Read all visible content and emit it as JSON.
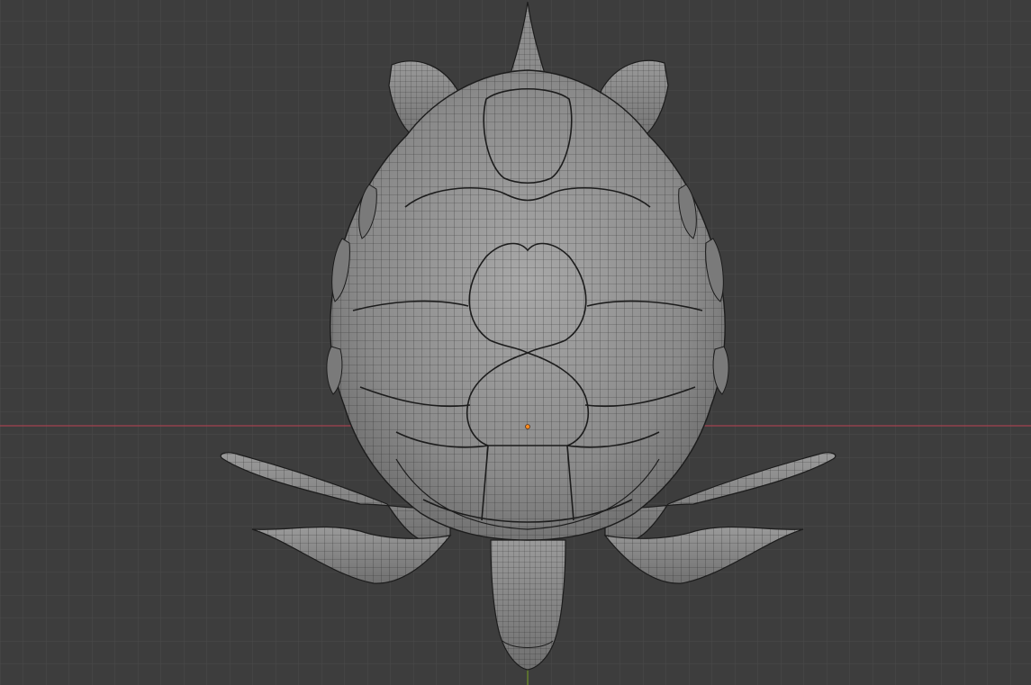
{
  "viewport": {
    "kind": "3d-viewport",
    "view": "top-orthographic",
    "grid": true,
    "colors": {
      "background": "#3d3d3d",
      "grid_line": "#4a4a4a",
      "x_axis": "#a3434f",
      "y_axis": "#6b8e23",
      "origin": "#ff8a1f",
      "mesh_fill": "#8e8e8e",
      "wire": "#1c1c1c"
    }
  },
  "object": {
    "name": "",
    "display": "wireframe-over-solid",
    "icon": "sea-turtle-mesh"
  }
}
